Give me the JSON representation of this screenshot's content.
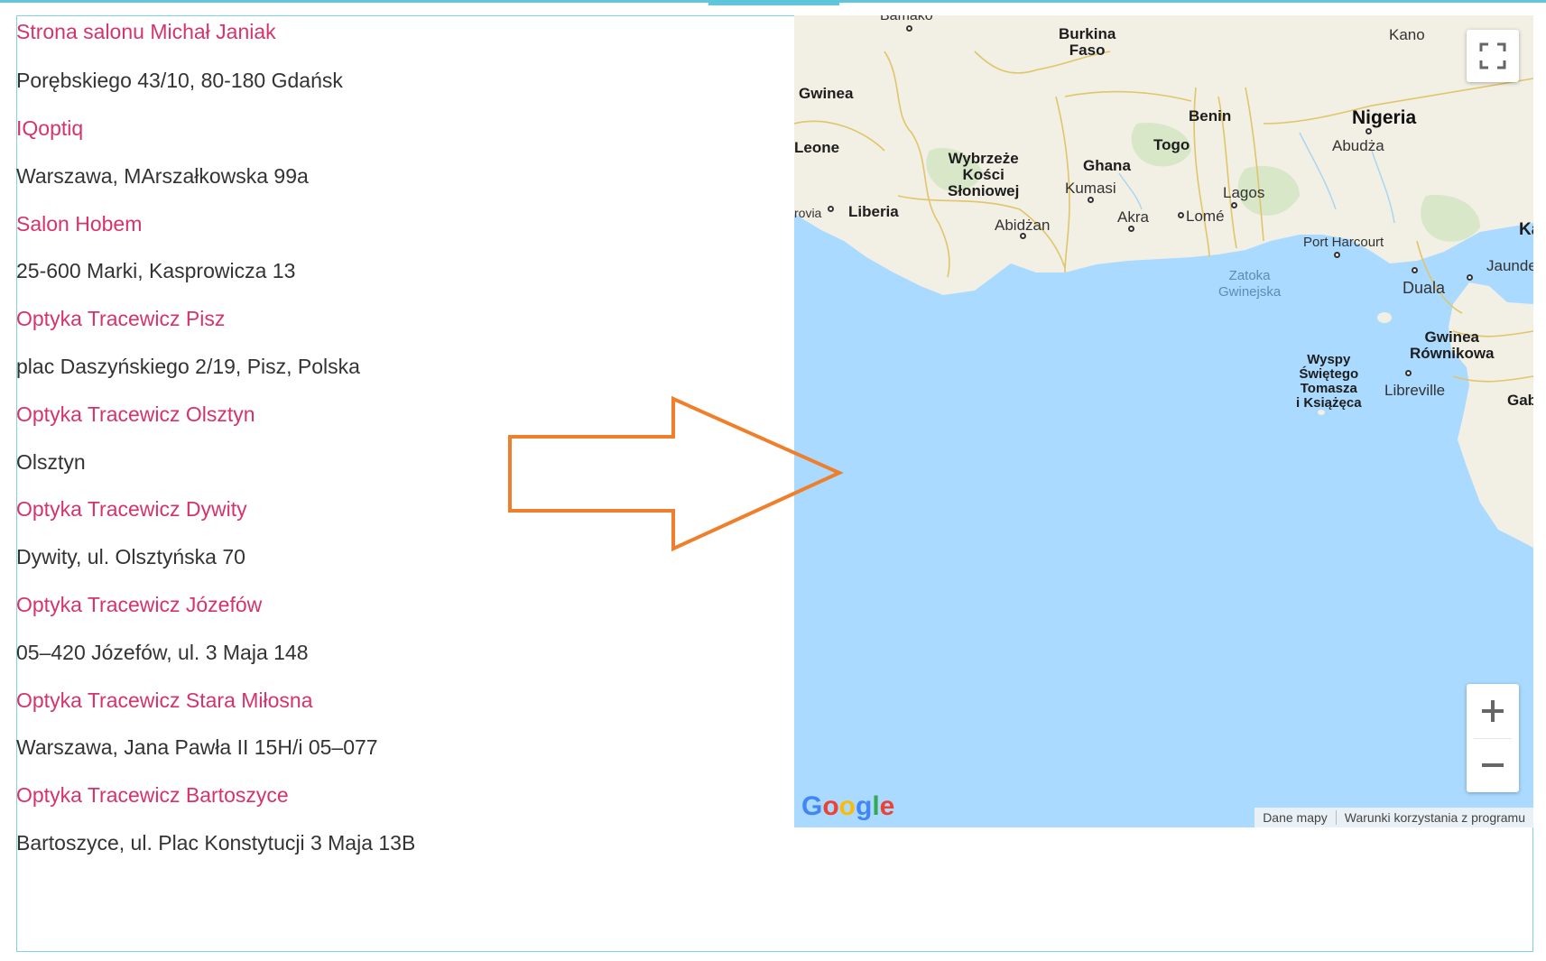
{
  "salons": [
    {
      "name": "Strona salonu Michał Janiak",
      "address": "Porębskiego 43/10, 80-180 Gdańsk"
    },
    {
      "name": "IQoptiq",
      "address": "Warszawa, MArszałkowska 99a"
    },
    {
      "name": "Salon Hobem",
      "address": "25-600 Marki, Kasprowicza 13"
    },
    {
      "name": "Optyka Tracewicz Pisz",
      "address": "plac Daszyńskiego 2/19, Pisz, Polska"
    },
    {
      "name": "Optyka Tracewicz Olsztyn",
      "address": "Olsztyn"
    },
    {
      "name": "Optyka Tracewicz Dywity",
      "address": "Dywity, ul. Olsztyńska 70"
    },
    {
      "name": "Optyka Tracewicz Józefów",
      "address": "05–420 Józefów, ul. 3 Maja 148"
    },
    {
      "name": "Optyka Tracewicz Stara Miłosna",
      "address": "Warszawa, Jana Pawła II 15H/i 05–077"
    },
    {
      "name": "Optyka Tracewicz Bartoszyce",
      "address": "Bartoszyce, ul. Plac Konstytucji 3 Maja 13B"
    }
  ],
  "map": {
    "labels": {
      "bamako": "Bamako",
      "burkina": "Burkina\nFaso",
      "kano": "Kano",
      "gwinea": "Gwinea",
      "benin": "Benin",
      "nigeria": "Nigeria",
      "abudza": "Abudża",
      "leone": "Leone",
      "togo": "Togo",
      "wybrzeze": "Wybrzeże\nKości\nSłoniowej",
      "ghana": "Ghana",
      "kumasi": "Kumasi",
      "liberia": "Liberia",
      "rovia": "rovia",
      "lagos": "Lagos",
      "abidzan": "Abidżan",
      "akra": "Akra",
      "lome": "Lomé",
      "portharcourt": "Port Harcourt",
      "ka": "Ka",
      "zatoka": "Zatoka\nGwinejska",
      "jaunde": "Jaunde",
      "duala": "Duala",
      "gwineaeq": "Gwinea\nRównikowa",
      "wyspy": "Wyspy\nŚwiętego\nTomasza\ni Książęca",
      "libreville": "Libreville",
      "gab": "Gab"
    },
    "google": "Google",
    "attribution": {
      "data": "Dane mapy",
      "terms": "Warunki korzystania z programu"
    },
    "controls": {
      "fullscreen": "fullscreen-icon",
      "zoom_in": "plus-icon",
      "zoom_out": "minus-icon"
    },
    "colors": {
      "water": "#aadaff",
      "land": "#f2efe4",
      "border": "#e0c56a",
      "arrow": "#f07f2b",
      "link": "#d6336c"
    }
  }
}
